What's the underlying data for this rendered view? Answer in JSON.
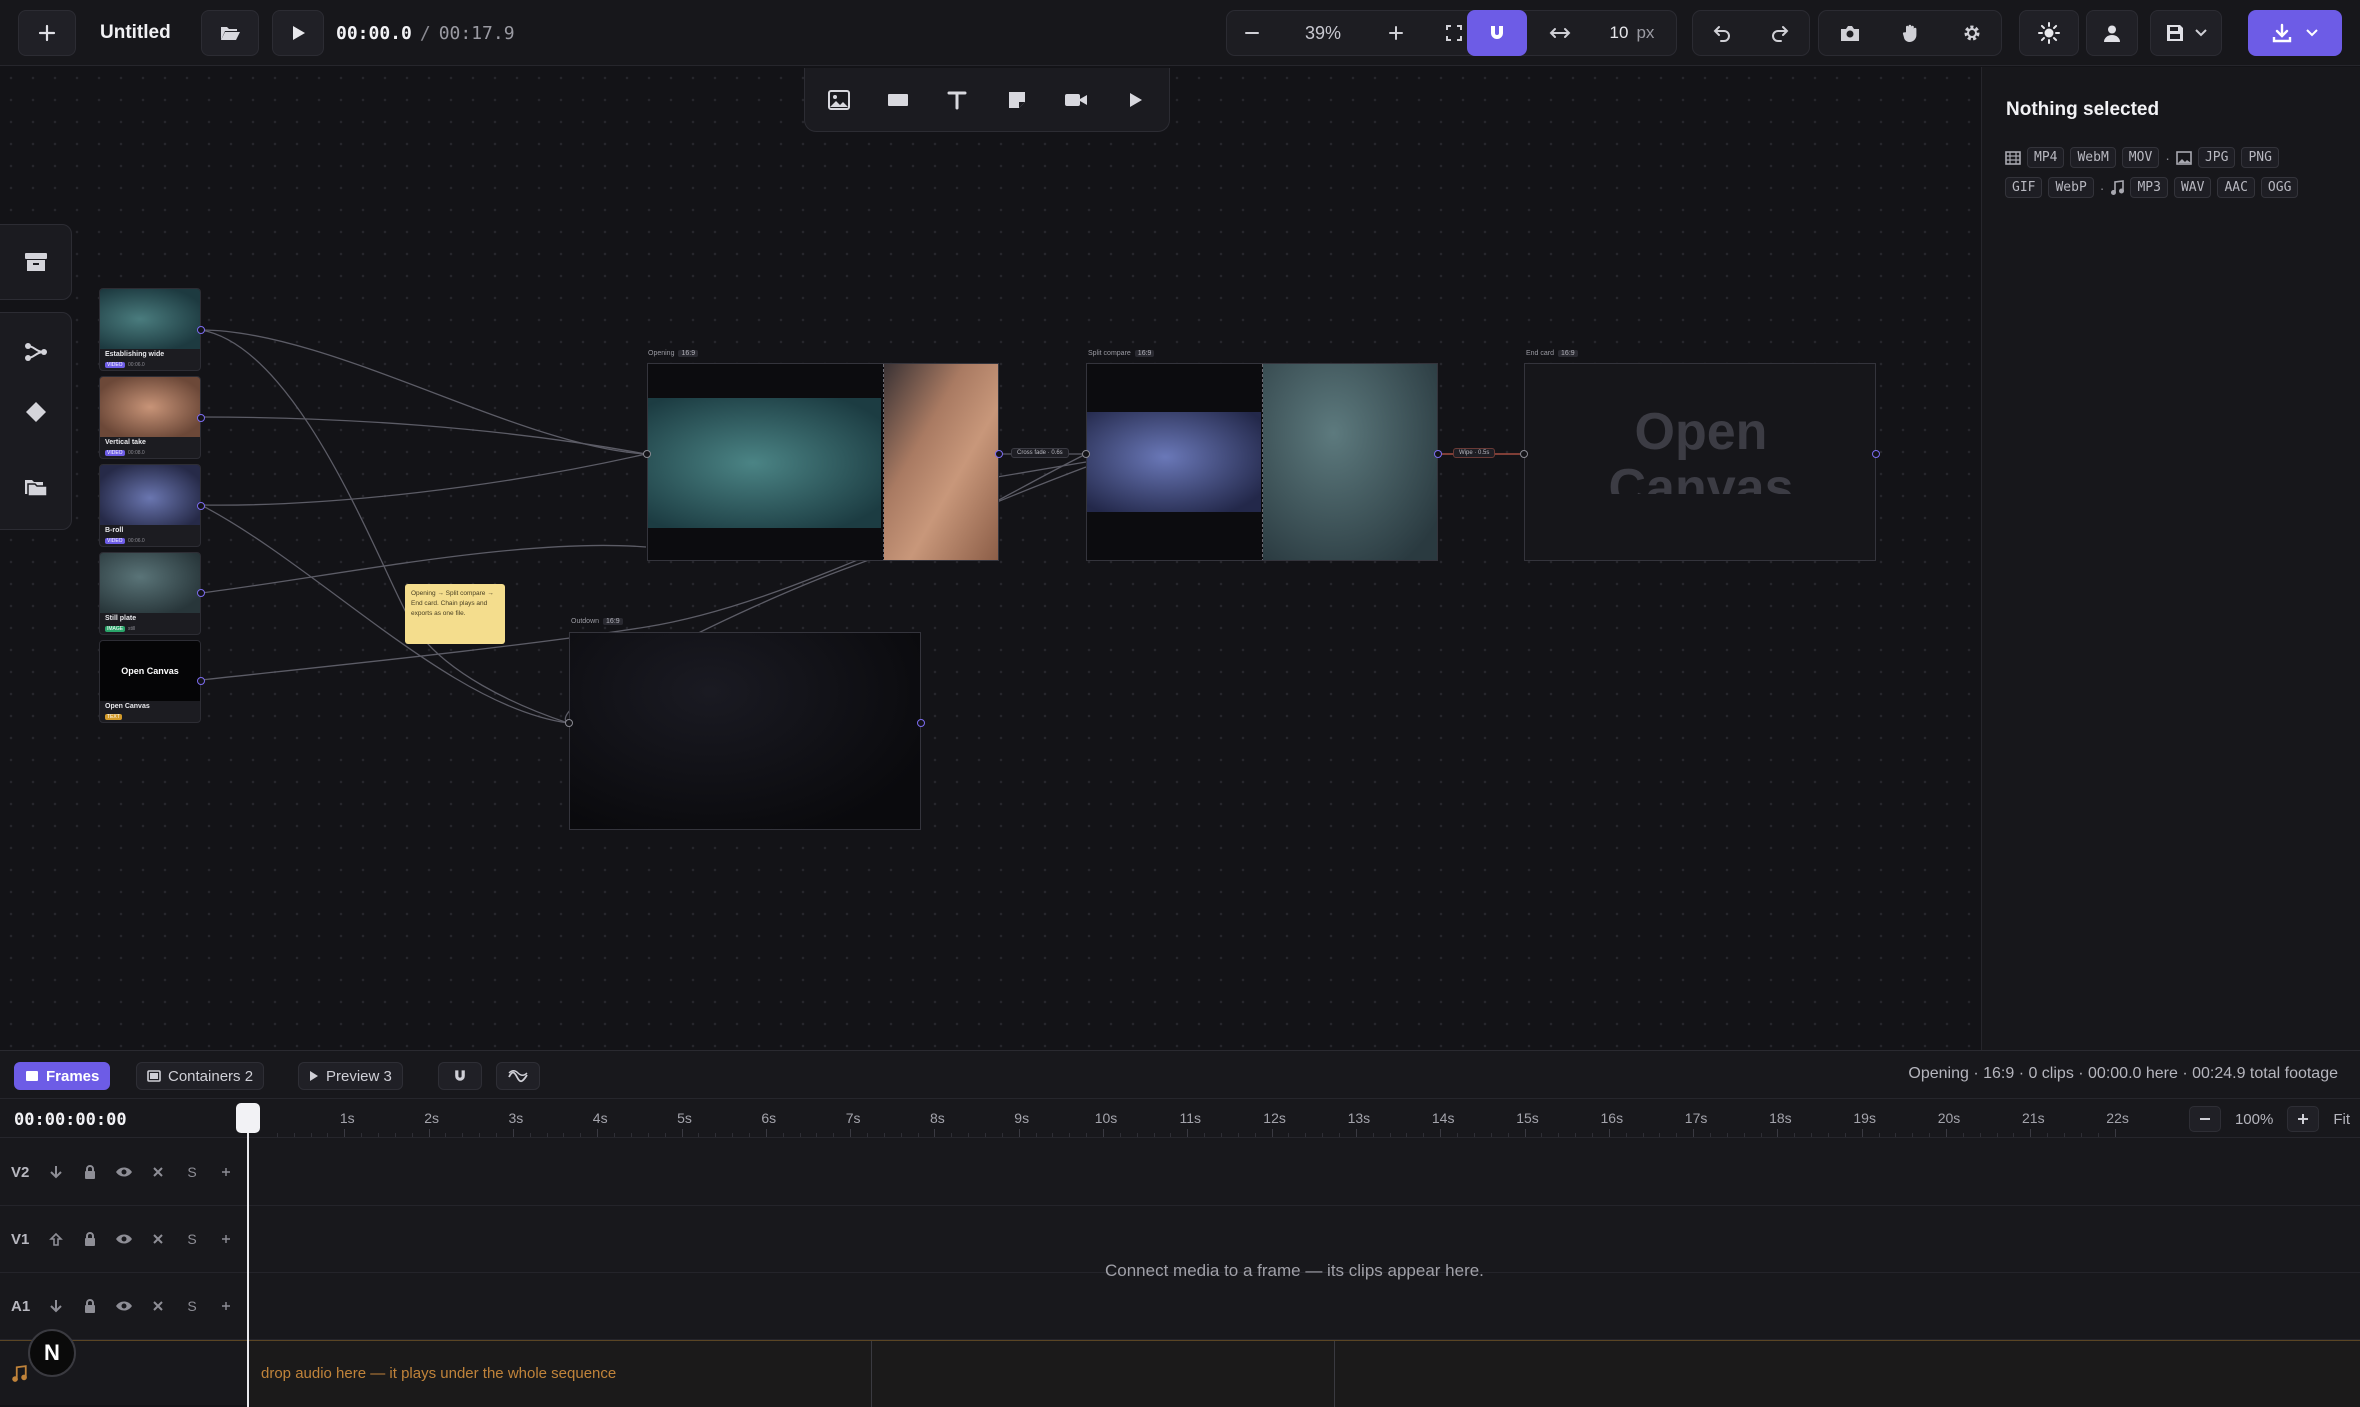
{
  "colors": {
    "accent": "#6d5ce6",
    "note": "#f4dd8d",
    "audio_hint": "#c0833a"
  },
  "topbar": {
    "project_title": "Untitled",
    "time_current": "00:00.0",
    "time_separator": "/",
    "time_total": "00:17.9",
    "zoom": "39%",
    "snap_value": "10",
    "snap_unit": "px"
  },
  "canvas": {
    "sources": [
      {
        "label": "Establishing wide",
        "badge": "VIDEO",
        "duration": "00:06.0",
        "badge_color": "#6d5ce6"
      },
      {
        "label": "Vertical take",
        "badge": "VIDEO",
        "duration": "00:08.0",
        "badge_color": "#6d5ce6"
      },
      {
        "label": "B-roll",
        "badge": "VIDEO",
        "duration": "00:06.0",
        "badge_color": "#6d5ce6"
      },
      {
        "label": "Still plate",
        "badge": "IMAGE",
        "duration": "still",
        "badge_color": "#2aa56a"
      },
      {
        "label": "Open Canvas",
        "badge": "TEXT",
        "duration": "",
        "badge_color": "#d29a2a",
        "preview_text": "Open Canvas"
      }
    ],
    "frames": {
      "opening": {
        "label": "Opening",
        "ratio": "16:9"
      },
      "split": {
        "label": "Split compare",
        "ratio": "16:9"
      },
      "endcard": {
        "label": "End card",
        "ratio": "16:9",
        "big_text": "Open Canvas"
      },
      "outdown": {
        "label": "Outdown",
        "ratio": "16:9"
      }
    },
    "transitions": {
      "crossfade": "Cross fade · 0.6s",
      "wipe": "Wipe · 0.5s"
    },
    "note": "Opening → Split compare → End card. Chain plays and exports as one file."
  },
  "inspector": {
    "title": "Nothing selected",
    "video_formats": [
      "MP4",
      "WebM",
      "MOV"
    ],
    "image_formats": [
      "JPG",
      "PNG",
      "GIF",
      "WebP"
    ],
    "audio_formats": [
      "MP3",
      "WAV",
      "AAC",
      "OGG"
    ]
  },
  "timeline": {
    "tabs": {
      "frames": "Frames",
      "containers": "Containers 2",
      "preview": "Preview 3"
    },
    "status": "Opening · 16:9 · 0 clips · 00:00.0 here · 00:24.9 total footage",
    "timecode": "00:00:00:00",
    "ticks": [
      "1s",
      "2s",
      "3s",
      "4s",
      "5s",
      "6s",
      "7s",
      "8s",
      "9s",
      "10s",
      "11s",
      "12s",
      "13s",
      "14s",
      "15s",
      "16s",
      "17s",
      "18s",
      "19s",
      "20s",
      "21s",
      "22s"
    ],
    "zoom": "100%",
    "fit": "Fit",
    "tracks": [
      {
        "name": "V2",
        "solo": "S"
      },
      {
        "name": "V1",
        "solo": "S"
      },
      {
        "name": "A1",
        "solo": "S"
      }
    ],
    "empty_message": "Connect media to a frame — its clips appear here.",
    "audio_hint": "drop audio here — it plays under the whole sequence",
    "avatar_letter": "N"
  }
}
